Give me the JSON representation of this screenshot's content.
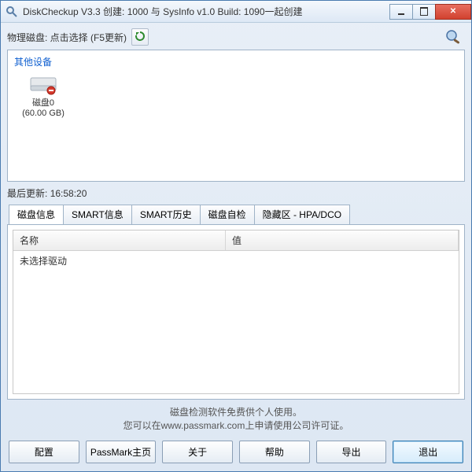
{
  "window": {
    "title": "DiskCheckup V3.3 创建: 1000 与 SysInfo v1.0 Build: 1090一起创建"
  },
  "top": {
    "label": "物理磁盘: 点击选择 (F5更新)"
  },
  "devices": {
    "group_title": "其他设备",
    "items": [
      {
        "name": "磁盘0",
        "size": "(60.00 GB)"
      }
    ]
  },
  "status": {
    "last_update_label": "最后更新:",
    "last_update_time": "16:58:20"
  },
  "tabs": [
    {
      "label": "磁盘信息",
      "active": true
    },
    {
      "label": "SMART信息",
      "active": false
    },
    {
      "label": "SMART历史",
      "active": false
    },
    {
      "label": "磁盘自检",
      "active": false
    },
    {
      "label": "隐藏区 - HPA/DCO",
      "active": false
    }
  ],
  "table": {
    "col_name": "名称",
    "col_value": "值",
    "empty_row": "未选择驱动"
  },
  "footer": {
    "line1": "磁盘检测软件免费供个人使用。",
    "line2": "您可以在www.passmark.com上申请使用公司许可证。"
  },
  "buttons": {
    "config": "配置",
    "passmark": "PassMark主页",
    "about": "关于",
    "help": "帮助",
    "export": "导出",
    "exit": "退出"
  }
}
